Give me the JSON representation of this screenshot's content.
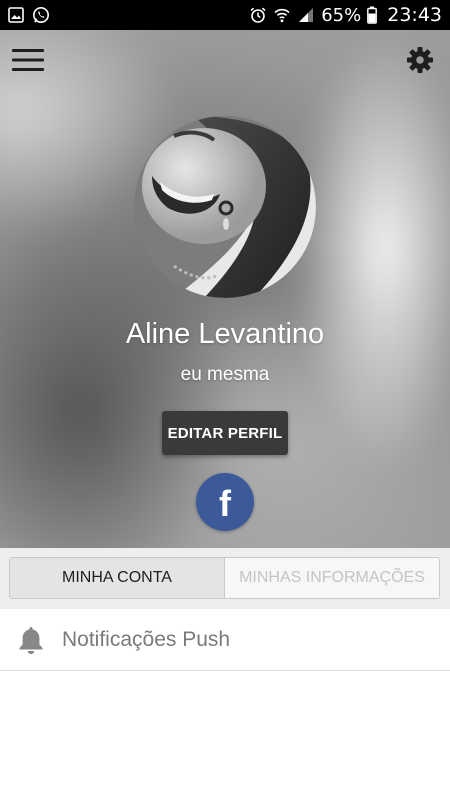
{
  "status_bar": {
    "battery": "65%",
    "time": "23:43",
    "icons": [
      "gallery-icon",
      "whatsapp-icon",
      "alarm-icon",
      "wifi-icon",
      "signal-icon",
      "battery-icon"
    ]
  },
  "header": {
    "menu_icon": "hamburger-menu-icon",
    "settings_icon": "gear-icon"
  },
  "profile": {
    "name": "Aline Levantino",
    "subtitle": "eu mesma",
    "edit_button": "EDITAR PERFIL",
    "social": "facebook",
    "social_letter": "f"
  },
  "tabs": [
    {
      "label": "MINHA CONTA",
      "active": true
    },
    {
      "label": "MINHAS INFORMAÇÕES",
      "active": false
    }
  ],
  "list": [
    {
      "icon": "bell-icon",
      "label": "Notificações Push"
    }
  ],
  "colors": {
    "status_bar": "#000000",
    "edit_button_bg": "#3a3a3a",
    "facebook_blue": "#3c5a99",
    "tab_active_bg": "#e4e4e4",
    "tab_inactive_text": "#c4c4c4",
    "list_text": "#7a7a7a"
  }
}
